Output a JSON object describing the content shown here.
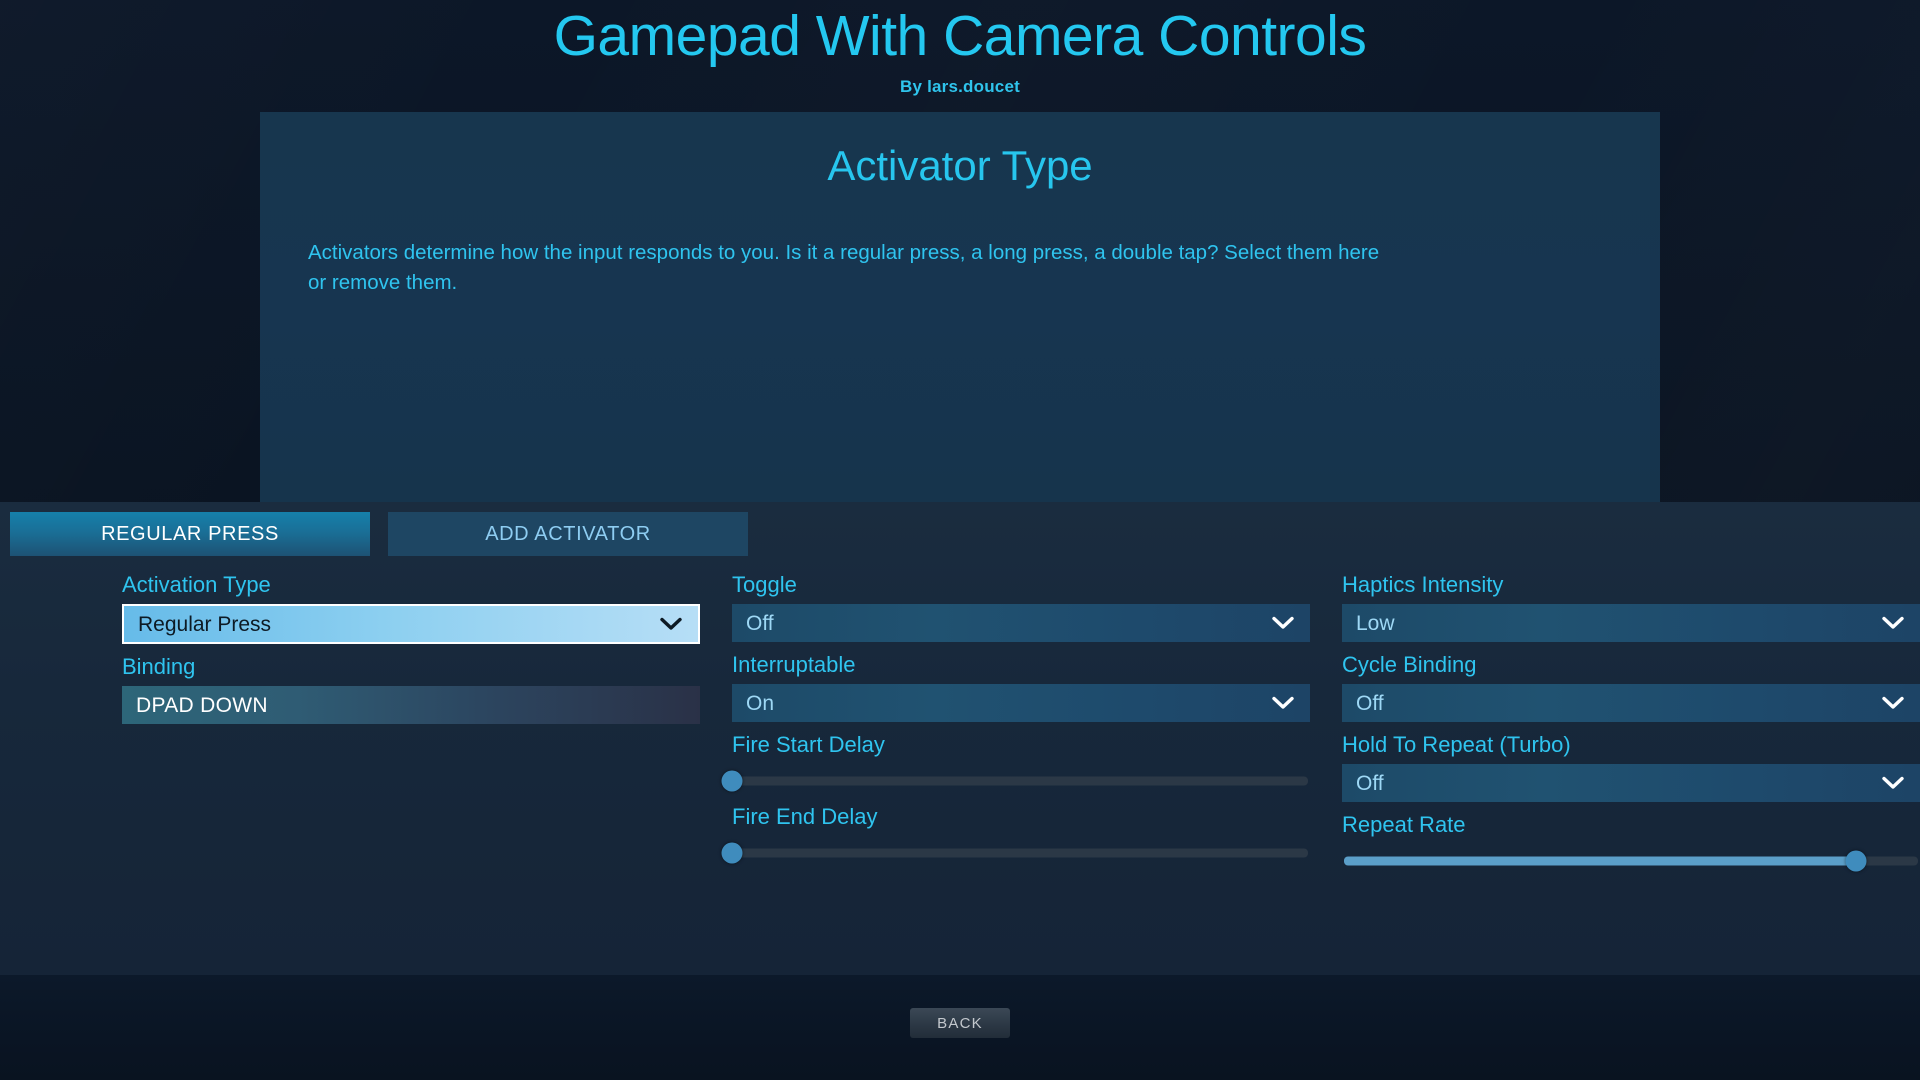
{
  "header": {
    "app_title": "Gamepad With Camera Controls",
    "author": "By lars.doucet"
  },
  "panel": {
    "title": "Activator Type",
    "description": "Activators determine how the input responds to you.  Is it a regular press, a long press, a double tap? Select them here or remove them."
  },
  "tabs": [
    {
      "label": "REGULAR PRESS",
      "active": true
    },
    {
      "label": "ADD ACTIVATOR",
      "active": false
    }
  ],
  "columns": {
    "col1": {
      "activation_type": {
        "label": "Activation Type",
        "value": "Regular Press",
        "focused": true
      },
      "binding": {
        "label": "Binding",
        "value": "DPAD DOWN"
      }
    },
    "col2": {
      "toggle": {
        "label": "Toggle",
        "value": "Off"
      },
      "interruptable": {
        "label": "Interruptable",
        "value": "On"
      },
      "fire_start_delay": {
        "label": "Fire Start Delay",
        "percent": 0
      },
      "fire_end_delay": {
        "label": "Fire End Delay",
        "percent": 0
      }
    },
    "col3": {
      "haptics_intensity": {
        "label": "Haptics Intensity",
        "value": "Low"
      },
      "cycle_binding": {
        "label": "Cycle Binding",
        "value": "Off"
      },
      "hold_to_repeat": {
        "label": "Hold To Repeat (Turbo)",
        "value": "Off"
      },
      "repeat_rate": {
        "label": "Repeat Rate",
        "percent": 89
      }
    }
  },
  "footer": {
    "back_label": "BACK"
  },
  "colors": {
    "accent_cyan": "#2fc4ef",
    "title_cyan": "#24c8f0",
    "active_tab": "#1a6e95",
    "focus_highlight": "#8ccff0",
    "slider_fill": "#5b9fc9",
    "slider_thumb": "#3f8cbd",
    "panel_bg": "#173550",
    "page_bg": "#0a1422"
  }
}
